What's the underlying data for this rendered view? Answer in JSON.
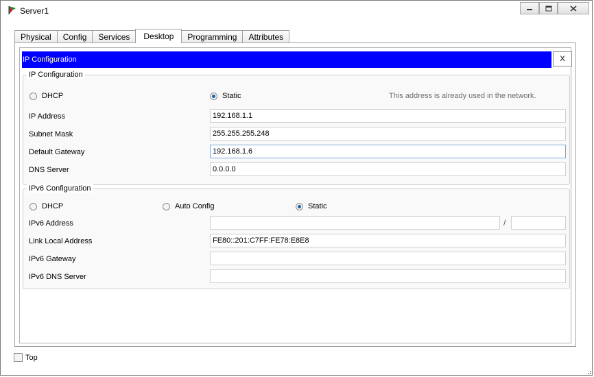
{
  "window": {
    "title": "Server1",
    "icon": "packet-tracer-server-icon",
    "controls": {
      "minimize": "minimize-icon",
      "maximize": "maximize-icon",
      "close": "close-icon"
    }
  },
  "tabs": [
    {
      "label": "Physical",
      "active": false
    },
    {
      "label": "Config",
      "active": false
    },
    {
      "label": "Services",
      "active": false
    },
    {
      "label": "Desktop",
      "active": true
    },
    {
      "label": "Programming",
      "active": false
    },
    {
      "label": "Attributes",
      "active": false
    }
  ],
  "panel": {
    "title": "IP Configuration",
    "close_label": "X"
  },
  "ipv4": {
    "group_title": "IP Configuration",
    "dhcp_label": "DHCP",
    "static_label": "Static",
    "mode": "static",
    "notice": "This address is already used in the network.",
    "ip_label": "IP Address",
    "ip_value": "192.168.1.1",
    "subnet_label": "Subnet Mask",
    "subnet_value": "255.255.255.248",
    "gateway_label": "Default Gateway",
    "gateway_value": "192.168.1.6",
    "dns_label": "DNS Server",
    "dns_value": "0.0.0.0"
  },
  "ipv6": {
    "group_title": "IPv6 Configuration",
    "dhcp_label": "DHCP",
    "auto_label": "Auto Config",
    "static_label": "Static",
    "mode": "static",
    "address_label": "IPv6 Address",
    "address_value": "",
    "prefix_separator": "/",
    "prefix_value": "",
    "link_local_label": "Link Local Address",
    "link_local_value": "FE80::201:C7FF:FE78:E8E8",
    "gateway_label": "IPv6 Gateway",
    "gateway_value": "",
    "dns_label": "IPv6 DNS Server",
    "dns_value": ""
  },
  "footer": {
    "top_label": "Top",
    "top_checked": false
  },
  "colors": {
    "title_bar": "#0000ff",
    "radio_selected": "#1f5f9e",
    "notice_text": "#6d6d6d"
  }
}
